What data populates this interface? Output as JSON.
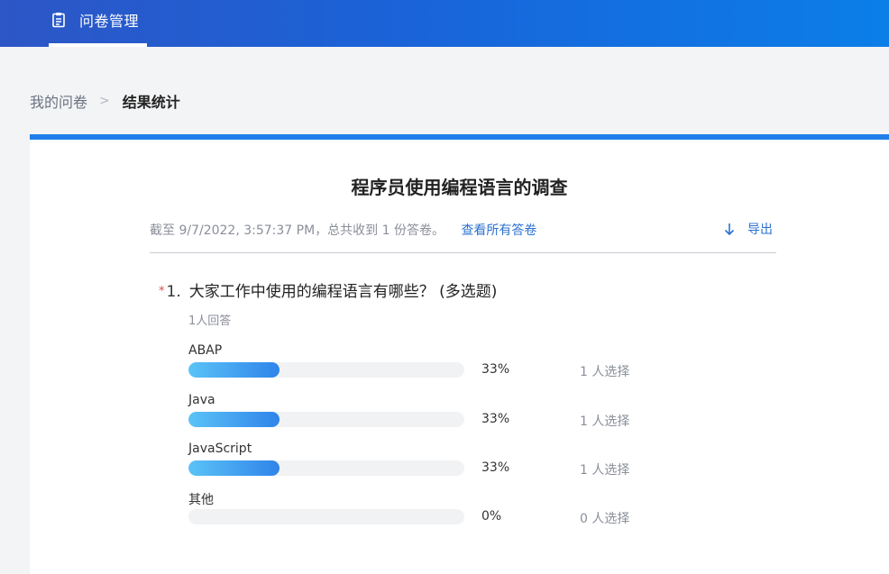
{
  "header": {
    "tab_label": "问卷管理",
    "tab_icon": "clipboard-icon"
  },
  "breadcrumb": {
    "parent": "我的问卷",
    "separator": ">",
    "current": "结果统计"
  },
  "survey": {
    "title": "程序员使用编程语言的调查",
    "meta_text": "截至 9/7/2022, 3:57:37 PM，总共收到 1 份答卷。",
    "view_all_label": "查看所有答卷",
    "export_label": "导出",
    "export_icon": "download-arrow-icon"
  },
  "question": {
    "required_mark": "*",
    "number": "1.",
    "text": "大家工作中使用的编程语言有哪些？ (多选题)",
    "answer_count": "1人回答",
    "options": [
      {
        "label": "ABAP",
        "percent": "33%",
        "fraction": 0.33,
        "count_text": "1 人选择"
      },
      {
        "label": "Java",
        "percent": "33%",
        "fraction": 0.33,
        "count_text": "1 人选择"
      },
      {
        "label": "JavaScript",
        "percent": "33%",
        "fraction": 0.33,
        "count_text": "1 人选择"
      },
      {
        "label": "其他",
        "percent": "0%",
        "fraction": 0,
        "count_text": "0 人选择"
      }
    ]
  },
  "colors": {
    "accent": "#1f80ea",
    "bar_start": "#5bc3f7",
    "bar_end": "#2f84ea",
    "required": "#e34b4b",
    "link": "#2b72d0"
  }
}
